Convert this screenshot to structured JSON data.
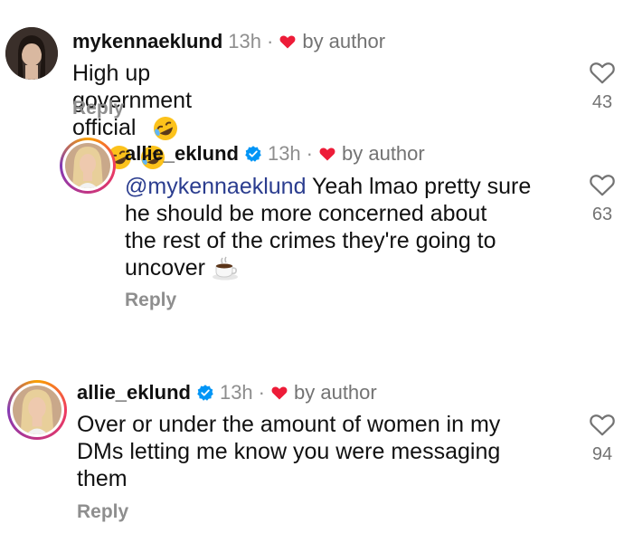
{
  "comments": [
    {
      "username": "mykennaeklund",
      "time": "13h",
      "dot": "·",
      "liked_by": "by author",
      "text": "High up government official",
      "emoji_icons": [
        "rolling-laughing-emoji",
        "rolling-laughing-emoji",
        "rolling-laughing-emoji",
        "rolling-laughing-emoji"
      ],
      "reply_label": "Reply",
      "like_count": "43",
      "verified": false
    },
    {
      "username": "allie_eklund",
      "time": "13h",
      "dot": "·",
      "liked_by": "by author",
      "mention": "@mykennaeklund",
      "text_lines": [
        "Yeah lmao pretty sure",
        "he should be more concerned about",
        "the rest of the crimes they're going to",
        "uncover"
      ],
      "emoji_icons": [
        "coffee-emoji"
      ],
      "reply_label": "Reply",
      "like_count": "63",
      "verified": true
    },
    {
      "username": "allie_eklund",
      "time": "13h",
      "dot": "·",
      "liked_by": "by author",
      "text_lines": [
        "Over or under the amount of women in my",
        "DMs letting me know you were messaging",
        "them"
      ],
      "reply_label": "Reply",
      "like_count": "94",
      "verified": true
    }
  ],
  "colors": {
    "heart": "#ed1c38",
    "verified": "#0095f6",
    "mention": "#2b3d8f",
    "muted": "#8e8e8e"
  }
}
